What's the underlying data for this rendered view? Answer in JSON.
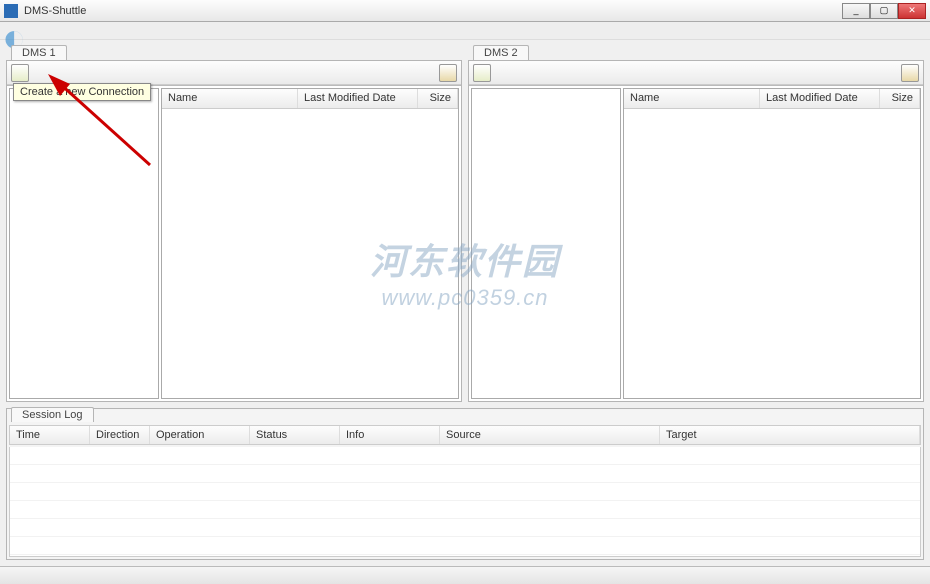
{
  "window": {
    "title": "DMS-Shuttle",
    "min": "_",
    "max": "▢",
    "close": "✕"
  },
  "panels": {
    "left": {
      "tab": "DMS 1",
      "tooltip": "Create a new Connection"
    },
    "right": {
      "tab": "DMS 2"
    }
  },
  "list_columns": {
    "name": "Name",
    "modified": "Last Modified Date",
    "size": "Size"
  },
  "session": {
    "tab": "Session Log",
    "columns": {
      "time": "Time",
      "direction": "Direction",
      "operation": "Operation",
      "status": "Status",
      "info": "Info",
      "source": "Source",
      "target": "Target"
    }
  },
  "watermark": {
    "line1": "河东软件园",
    "line2": "www.pc0359.cn"
  }
}
